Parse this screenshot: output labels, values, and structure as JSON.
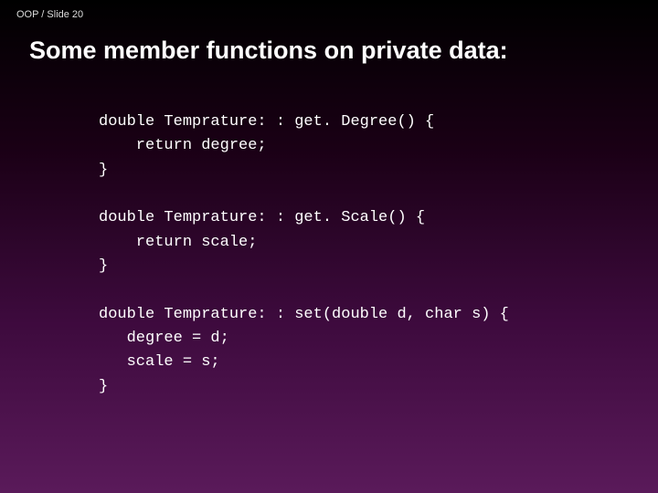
{
  "breadcrumb": "OOP / Slide 20",
  "title": "Some member functions on private data:",
  "code": "double Temprature: : get. Degree() {\n    return degree;\n}\n\ndouble Temprature: : get. Scale() {\n    return scale;\n}\n\ndouble Temprature: : set(double d, char s) {\n   degree = d;\n   scale = s;\n}"
}
